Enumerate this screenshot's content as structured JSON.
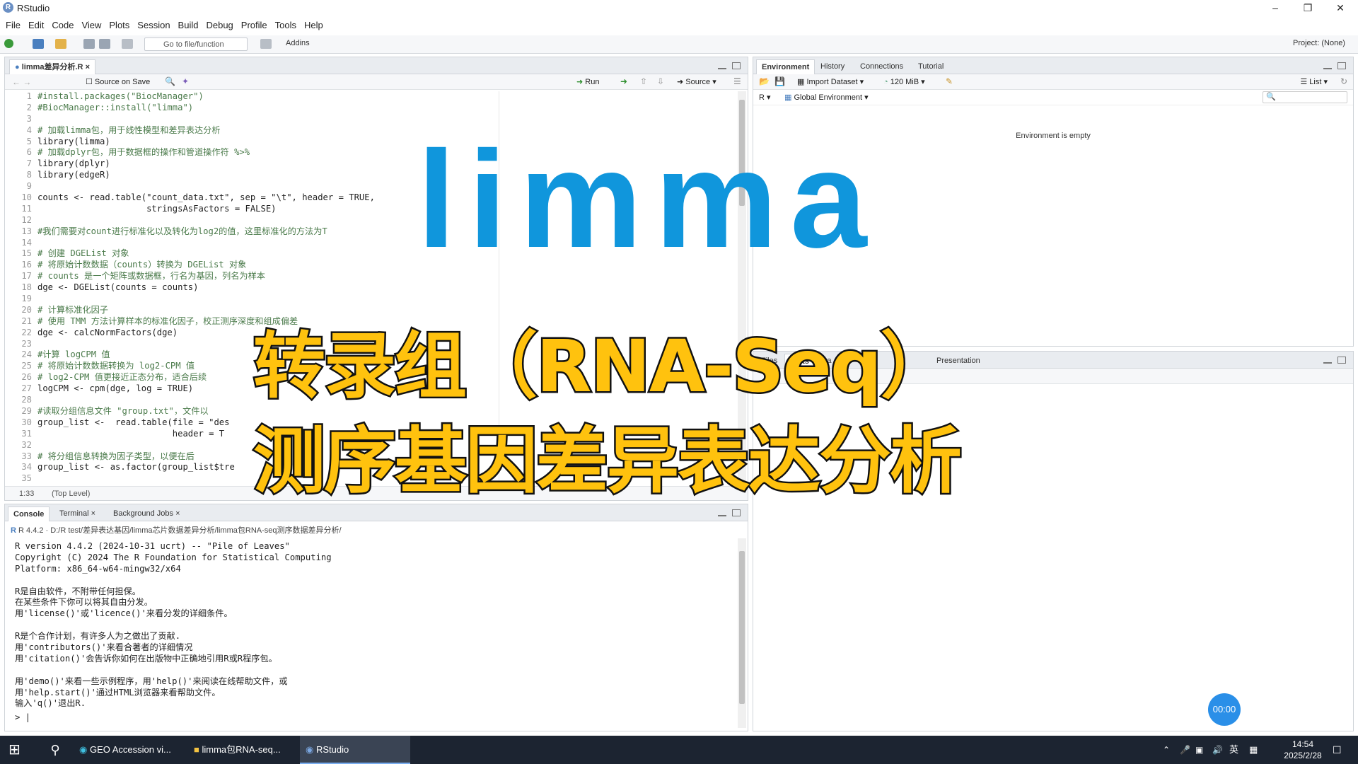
{
  "window": {
    "title": "RStudio",
    "app_icon": "R"
  },
  "menu": [
    "File",
    "Edit",
    "Code",
    "View",
    "Plots",
    "Session",
    "Build",
    "Debug",
    "Profile",
    "Tools",
    "Help"
  ],
  "toolbar": {
    "goto_placeholder": "Go to file/function",
    "addins": "Addins",
    "project": "Project: (None)"
  },
  "editor": {
    "tab": "limma差异分析.R",
    "source_on_save": "Source on Save",
    "run": "Run",
    "source": "Source",
    "status_pos": "1:33",
    "status_scope": "(Top Level)",
    "lines": [
      {
        "n": "1",
        "t": "#install.packages(\"BiocManager\")",
        "c": "cm"
      },
      {
        "n": "2",
        "t": "#BiocManager::install(\"limma\")",
        "c": "cm"
      },
      {
        "n": "3",
        "t": "",
        "c": ""
      },
      {
        "n": "4",
        "t": "# 加载limma包，用于线性模型和差异表达分析",
        "c": "cm"
      },
      {
        "n": "5",
        "t": "library(limma)",
        "c": ""
      },
      {
        "n": "6",
        "t": "# 加载dplyr包，用于数据框的操作和管道操作符 %>%",
        "c": "cm"
      },
      {
        "n": "7",
        "t": "library(dplyr)",
        "c": ""
      },
      {
        "n": "8",
        "t": "library(edgeR)",
        "c": ""
      },
      {
        "n": "9",
        "t": "",
        "c": ""
      },
      {
        "n": "10",
        "t": "counts <- read.table(\"count_data.txt\", sep = \"\\t\", header = TRUE,",
        "c": ""
      },
      {
        "n": "11",
        "t": "                     stringsAsFactors = FALSE)",
        "c": ""
      },
      {
        "n": "12",
        "t": "",
        "c": ""
      },
      {
        "n": "13",
        "t": "#我们需要对count进行标准化以及转化为log2的值，这里标准化的方法为T",
        "c": "cm"
      },
      {
        "n": "14",
        "t": "",
        "c": ""
      },
      {
        "n": "15",
        "t": "# 创建 DGEList 对象",
        "c": "cm"
      },
      {
        "n": "16",
        "t": "# 将原始计数数据（counts）转换为 DGEList 对象",
        "c": "cm"
      },
      {
        "n": "17",
        "t": "# counts 是一个矩阵或数据框，行名为基因，列名为样本",
        "c": "cm"
      },
      {
        "n": "18",
        "t": "dge <- DGEList(counts = counts)",
        "c": ""
      },
      {
        "n": "19",
        "t": "",
        "c": ""
      },
      {
        "n": "20",
        "t": "# 计算标准化因子",
        "c": "cm"
      },
      {
        "n": "21",
        "t": "# 使用 TMM 方法计算样本的标准化因子，校正测序深度和组成偏差",
        "c": "cm"
      },
      {
        "n": "22",
        "t": "dge <- calcNormFactors(dge)",
        "c": ""
      },
      {
        "n": "23",
        "t": "",
        "c": ""
      },
      {
        "n": "24",
        "t": "#计算 logCPM 值",
        "c": "cm"
      },
      {
        "n": "25",
        "t": "# 将原始计数数据转换为 log2-CPM 值",
        "c": "cm"
      },
      {
        "n": "26",
        "t": "# log2-CPM 值更接近正态分布，适合后续",
        "c": "cm"
      },
      {
        "n": "27",
        "t": "logCPM <- cpm(dge, log = TRUE)",
        "c": ""
      },
      {
        "n": "28",
        "t": "",
        "c": ""
      },
      {
        "n": "29",
        "t": "#读取分组信息文件 \"group.txt\"，文件以",
        "c": "cm"
      },
      {
        "n": "30",
        "t": "group_list <-  read.table(file = \"des",
        "c": ""
      },
      {
        "n": "31",
        "t": "                          header = T",
        "c": ""
      },
      {
        "n": "32",
        "t": "",
        "c": ""
      },
      {
        "n": "33",
        "t": "# 将分组信息转换为因子类型，以便在后",
        "c": "cm"
      },
      {
        "n": "34",
        "t": "group_list <- as.factor(group_list$tre",
        "c": ""
      },
      {
        "n": "35",
        "t": "",
        "c": ""
      }
    ]
  },
  "console": {
    "tabs": [
      "Console",
      "Terminal",
      "Background Jobs"
    ],
    "path": "R 4.4.2 · D:/R test/差异表达基因/limma芯片数据差异分析/limma包RNA-seq测序数据差异分析/",
    "lines": [
      "R version 4.4.2 (2024-10-31 ucrt) -- \"Pile of Leaves\"",
      "Copyright (C) 2024 The R Foundation for Statistical Computing",
      "Platform: x86_64-w64-mingw32/x64",
      "",
      "R是自由软件，不附带任何担保。",
      "在某些条件下你可以将其自由分发。",
      "用'license()'或'licence()'来看分发的详细条件。",
      "",
      "R是个合作计划，有许多人为之做出了贡献.",
      "用'contributors()'来看合著者的详细情况",
      "用'citation()'会告诉你如何在出版物中正确地引用R或R程序包。",
      "",
      "用'demo()'来看一些示例程序，用'help()'来阅读在线帮助文件，或",
      "用'help.start()'通过HTML浏览器来看帮助文件。",
      "输入'q()'退出R.",
      "",
      ""
    ],
    "prompt": ">"
  },
  "env": {
    "tabs": [
      "Environment",
      "History",
      "Connections",
      "Tutorial"
    ],
    "import": "Import Dataset",
    "memory": "120 MiB",
    "list": "List",
    "lang": "R",
    "scope": "Global Environment",
    "empty": "Environment is empty"
  },
  "files": {
    "tabs": [
      "Files",
      "Plots",
      "Pa",
      "Vi",
      "Presentation"
    ]
  },
  "overlay": {
    "title": "limma",
    "line1": "转录组（RNA-Seq）",
    "line2": "测序基因差异表达分析"
  },
  "timer": "00:00",
  "taskbar": {
    "items": [
      "GEO Accession vi...",
      "limma包RNA-seq...",
      "RStudio"
    ],
    "ime": "英",
    "time": "14:54",
    "date": "2025/2/28"
  }
}
